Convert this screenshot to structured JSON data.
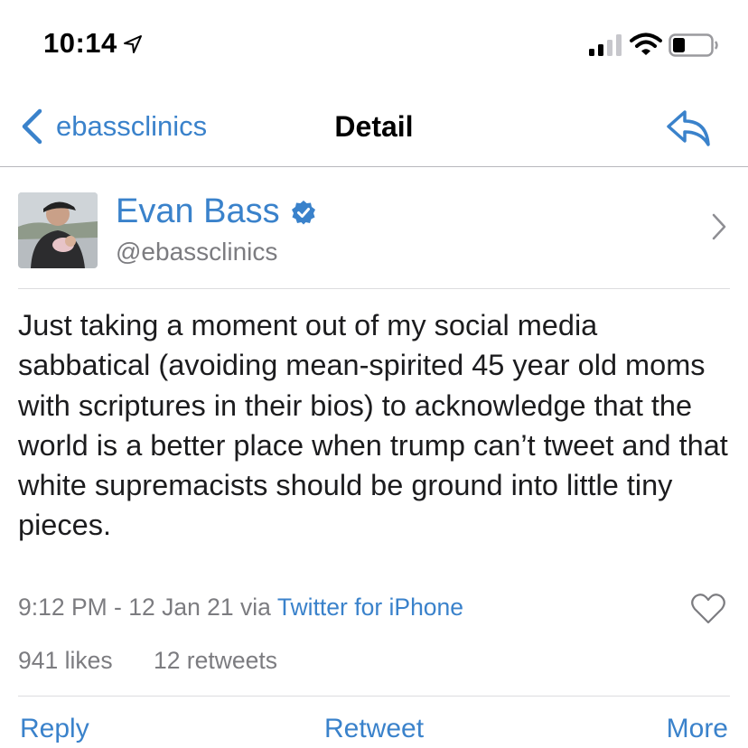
{
  "status_bar": {
    "time": "10:14",
    "icons": [
      "location-arrow-icon",
      "signal-bars-icon",
      "wifi-icon",
      "battery-icon"
    ]
  },
  "nav": {
    "back_label": "ebassclinics",
    "title": "Detail",
    "icons": {
      "back": "chevron-left-icon",
      "reply": "reply-arrow-icon"
    }
  },
  "colors": {
    "accent": "#3a82cb",
    "text": "#1c1c1e",
    "secondary_text": "#7c7c80",
    "divider": "#dcdcdf"
  },
  "profile": {
    "display_name": "Evan Bass",
    "handle": "@ebassclinics",
    "verified": true,
    "icons": {
      "verified": "verified-badge-icon",
      "disclosure": "chevron-right-icon"
    }
  },
  "tweet": {
    "text": "Just taking a moment out of my social media sabbatical (avoiding mean-spirited 45 year old moms with scriptures in their bios) to acknowledge that the world is a better place when trump can’t tweet and that white supremacists should be ground into little tiny pieces.",
    "timestamp": "9:12 PM - 12 Jan 21",
    "via": "via",
    "source": "Twitter for iPhone",
    "likes": "941 likes",
    "retweets": "12 retweets",
    "like_icon": "heart-outline-icon"
  },
  "actions": {
    "reply": "Reply",
    "retweet": "Retweet",
    "more": "More"
  }
}
